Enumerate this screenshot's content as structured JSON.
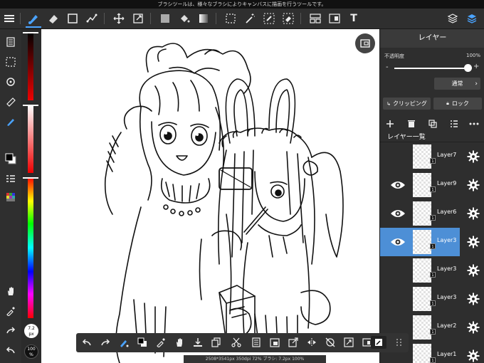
{
  "status_bar": {
    "text": "ブラシツールは、様々なブラシによりキャンバスに描画を行うツールです。"
  },
  "top_toolbar": {
    "tools": [
      "menu-icon",
      "brush-icon",
      "eraser-icon",
      "rectangle-icon",
      "lasso-fill-icon",
      "move-icon",
      "transform-icon",
      "fill-color-icon",
      "bucket-icon",
      "gradient-icon",
      "select-rect-icon",
      "magic-wand-icon",
      "select-pen-icon",
      "select-eraser-icon",
      "layout-icon",
      "frame-icon",
      "text-icon",
      "materials-icon",
      "layers-icon"
    ],
    "text_tool_label": "T"
  },
  "left_bar": {
    "tools": [
      "page-icon",
      "selection-icon",
      "rotate-icon",
      "ruler-icon",
      "pen-icon",
      "color-swatch-icon",
      "layers-list-icon",
      "palette-icon",
      "hand-icon",
      "eyedropper-icon",
      "redo-icon",
      "undo-icon"
    ]
  },
  "colors": {
    "primary": "#000000",
    "secondary": "#ffffff",
    "accent": "#4d8fd6",
    "hue_red": "#ff0000"
  },
  "brush": {
    "size": "7.2",
    "size_unit": "px",
    "opacity": "100",
    "opacity_unit": "%"
  },
  "layer_panel": {
    "title": "レイヤー",
    "opacity_label": "不透明度",
    "opacity_value": "100%",
    "opacity_fraction": 1.0,
    "minus": "-",
    "plus": "+",
    "blend_mode": "通常",
    "clipping_label": "クリッピング",
    "lock_label": "ロック",
    "list_title": "レイヤー一覧",
    "layers": [
      {
        "name": "Layer7",
        "visible": false,
        "selected": false
      },
      {
        "name": "Layer9",
        "visible": true,
        "selected": false
      },
      {
        "name": "Layer6",
        "visible": true,
        "selected": false
      },
      {
        "name": "Layer3",
        "visible": true,
        "selected": true
      },
      {
        "name": "Layer3",
        "visible": false,
        "selected": false
      },
      {
        "name": "Layer3",
        "visible": false,
        "selected": false
      },
      {
        "name": "Layer2",
        "visible": false,
        "selected": false
      },
      {
        "name": "Layer1",
        "visible": false,
        "selected": false
      }
    ],
    "badge": "1"
  },
  "bottom_toolbar": {
    "tools": [
      "undo-icon",
      "redo-icon",
      "brush-settings-icon",
      "color-swap-icon",
      "eyedropper-icon",
      "hand-icon",
      "import-icon",
      "duplicate-icon",
      "cut-icon",
      "copy-icon",
      "paste-icon",
      "export-icon",
      "flip-icon",
      "snap-off-icon",
      "fit-icon",
      "frame-icon",
      "edit-icon",
      "more-icon"
    ]
  },
  "canvas_info": {
    "text": "2508*3541px 350dpi 72% ブラシ: 7.2px 100%"
  }
}
